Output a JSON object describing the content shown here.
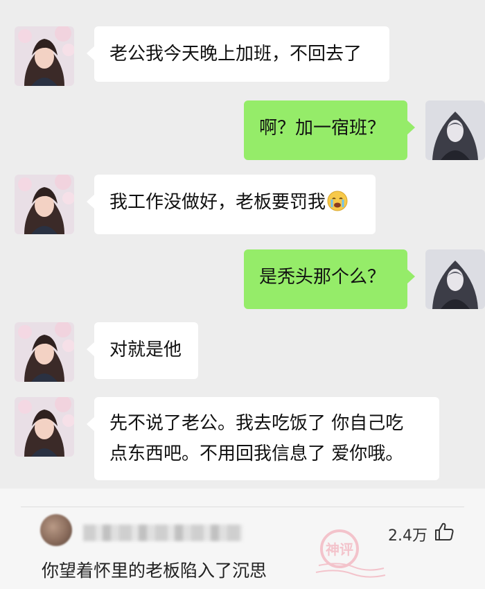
{
  "colors": {
    "background": "#ededed",
    "incoming_bubble": "#ffffff",
    "outgoing_bubble": "#95ec69",
    "comment_background": "#f6f6f6",
    "stamp": "#f29aa8"
  },
  "messages": [
    {
      "from": "her",
      "text": "老公我今天晚上加班，不回去了"
    },
    {
      "from": "me",
      "text": "啊？加一宿班？"
    },
    {
      "from": "her",
      "text": "我工作没做好，老板要罚我",
      "emoji": "crying-face-icon"
    },
    {
      "from": "me",
      "text": "是秃头那个么？"
    },
    {
      "from": "her",
      "text": "对就是他"
    },
    {
      "from": "her",
      "line1": "先不说了老公。我去吃饭了 你自己吃",
      "line2": "点东西吧。不用回我信息了 爱你哦。"
    }
  ],
  "comment": {
    "likes": "2.4万",
    "text": "你望着怀里的老板陷入了沉思",
    "stamp_text": "神评",
    "icons": [
      "blurred-avatar",
      "thumbs-up-icon",
      "stamp-icon"
    ]
  }
}
